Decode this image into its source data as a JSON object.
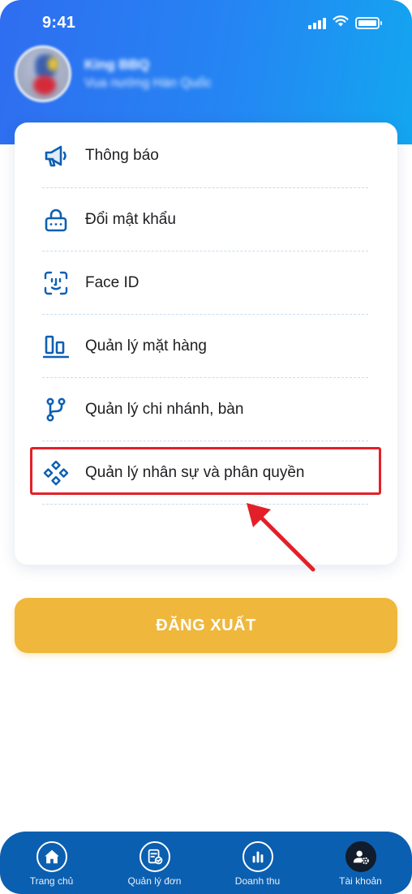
{
  "status_bar": {
    "time": "9:41"
  },
  "profile": {
    "name": "King BBQ",
    "subtitle": "Vua nướng Hàn Quốc"
  },
  "menu": {
    "items": [
      {
        "label": "Thông báo",
        "icon": "megaphone-icon"
      },
      {
        "label": "Đổi mật khẩu",
        "icon": "lock-password-icon"
      },
      {
        "label": "Face ID",
        "icon": "face-id-icon"
      },
      {
        "label": "Quản lý mặt hàng",
        "icon": "product-bars-icon"
      },
      {
        "label": "Quản lý chi nhánh, bàn",
        "icon": "branch-icon"
      },
      {
        "label": "Quản lý nhân sự và phân quyền",
        "icon": "diamond-grid-icon"
      }
    ],
    "highlighted_item": "Quản lý nhân sự và phân quyền"
  },
  "logout": {
    "label": "ĐĂNG XUẤT"
  },
  "tabbar": {
    "tabs": [
      {
        "label": "Trang chủ",
        "icon": "home-icon"
      },
      {
        "label": "Quản lý đơn",
        "icon": "order-icon"
      },
      {
        "label": "Doanh thu",
        "icon": "chart-icon"
      },
      {
        "label": "Tài khoản",
        "icon": "account-settings-icon"
      }
    ],
    "active_tab": "Tài khoản"
  },
  "colors": {
    "header_start": "#2f6df0",
    "header_end": "#13a6f0",
    "icon_blue": "#0d5fb3",
    "logout_button": "#efb73c",
    "tabbar": "#0b5fb0",
    "highlight": "#e32028"
  }
}
